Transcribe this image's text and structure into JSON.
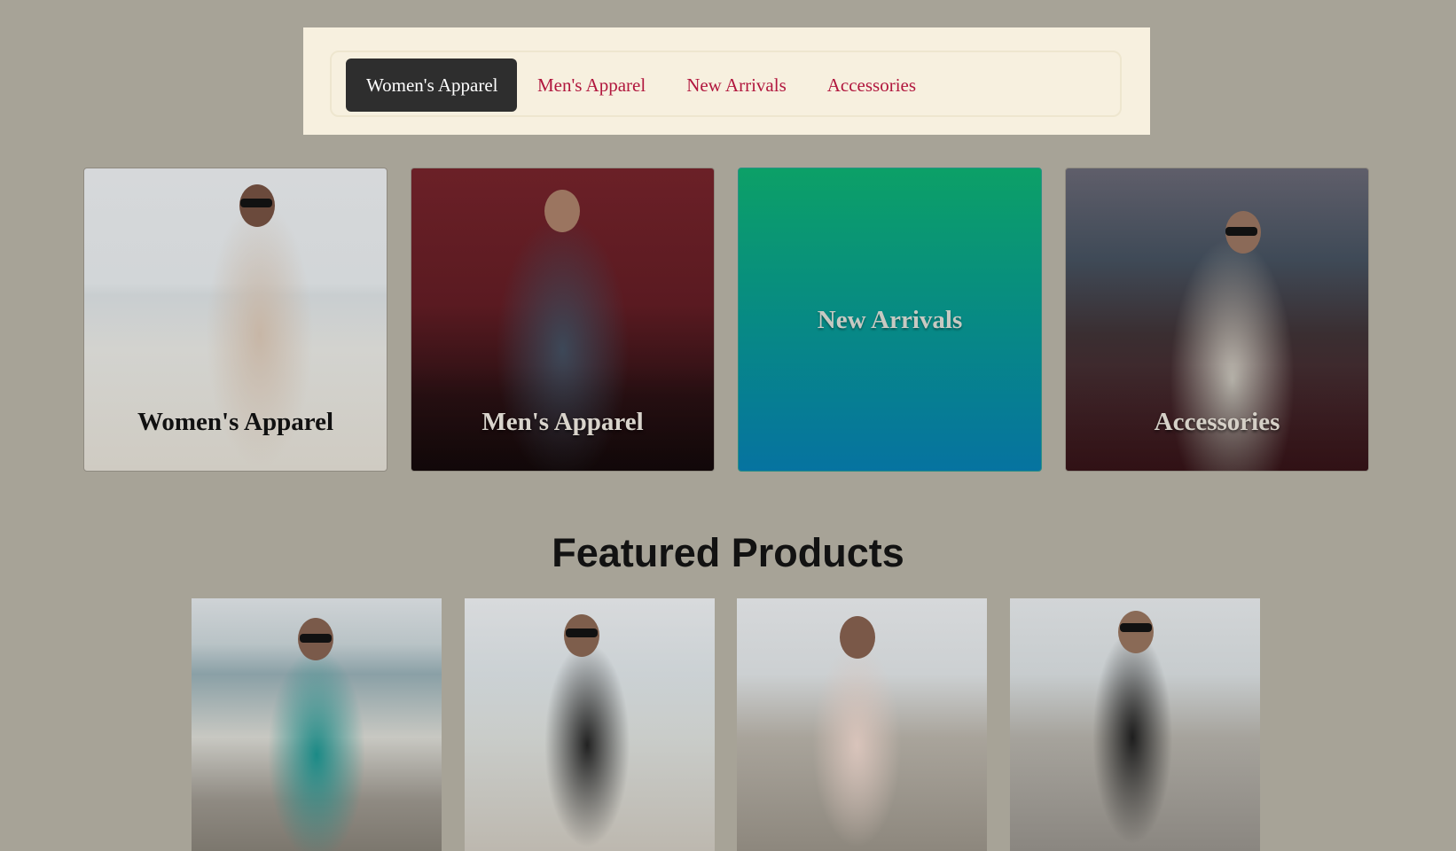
{
  "nav": {
    "items": [
      {
        "label": "Women's Apparel",
        "active": true
      },
      {
        "label": "Men's Apparel",
        "active": false
      },
      {
        "label": "New Arrivals",
        "active": false
      },
      {
        "label": "Accessories",
        "active": false
      }
    ]
  },
  "categories": [
    {
      "label": "Women's Apparel"
    },
    {
      "label": "Men's Apparel"
    },
    {
      "label": "New Arrivals"
    },
    {
      "label": "Accessories"
    }
  ],
  "featured": {
    "title": "Featured Products"
  },
  "colors": {
    "page_background": "#a7a397",
    "nav_background": "#f7f0df",
    "nav_link": "#b1173e",
    "nav_active_background": "#2e2e2e",
    "new_arrivals_gradient_top": "#0ca067",
    "new_arrivals_gradient_bottom": "#0673a0"
  }
}
